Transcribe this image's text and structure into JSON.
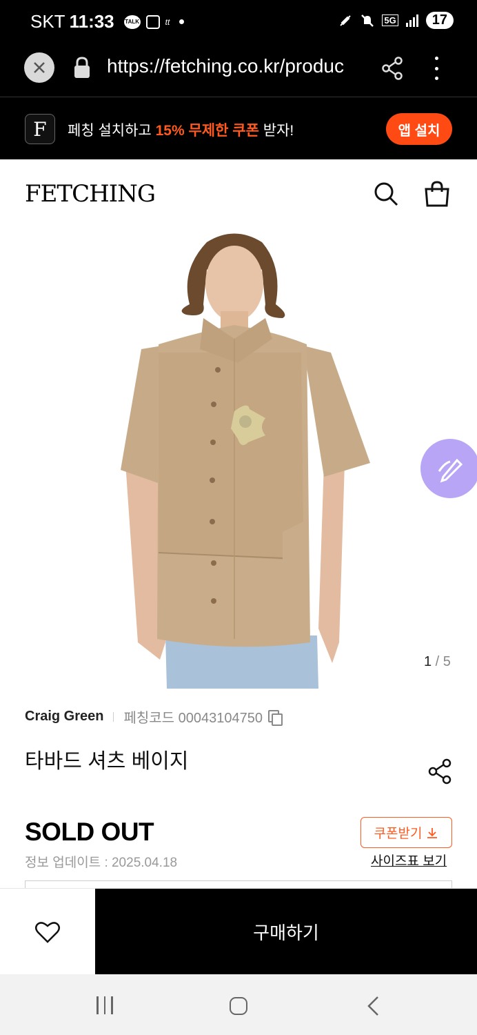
{
  "status_bar": {
    "carrier": "SKT",
    "time": "11:33",
    "talk_badge": "TALK",
    "app_badge": "tt",
    "network": "5G",
    "battery": "17"
  },
  "browser": {
    "url": "https://fetching.co.kr/produc"
  },
  "app_banner": {
    "logo_letter": "F",
    "text_before": "페칭 설치하고 ",
    "text_highlight": "15% 무제한 쿠폰",
    "text_after": " 받자!",
    "install_label": "앱 설치"
  },
  "site": {
    "logo": "FETCHING"
  },
  "gallery": {
    "current": "1",
    "separator": " / ",
    "total": "5"
  },
  "product": {
    "brand": "Craig Green",
    "code_label": "페칭코드 00043104750",
    "title": "타바드 셔츠 베이지",
    "status": "SOLD OUT",
    "update_info": "정보 업데이트 : 2025.04.18",
    "coupon_label": "쿠폰받기",
    "size_chart_label": "사이즈표 보기"
  },
  "bottom_bar": {
    "buy_label": "구매하기"
  },
  "colors": {
    "accent": "#ff4a14",
    "fab": "#b8a5f5",
    "shirt": "#c9ad8b"
  }
}
